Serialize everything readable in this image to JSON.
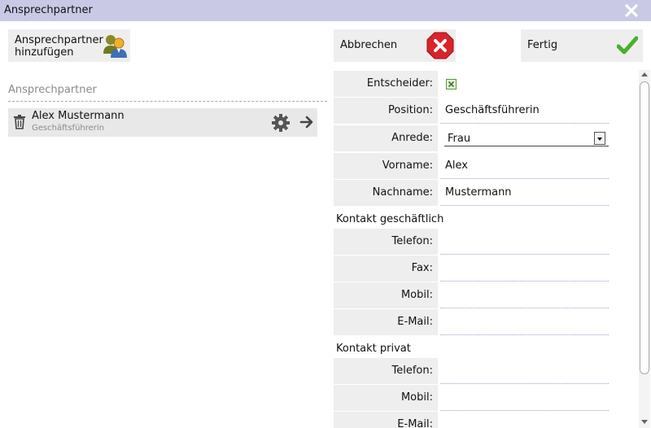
{
  "window": {
    "title": "Ansprechpartner"
  },
  "toolbar": {
    "add_line1": "Ansprechpartner",
    "add_line2": "hinzufügen",
    "cancel_label": "Abbrechen",
    "done_label": "Fertig"
  },
  "list": {
    "heading": "Ansprechpartner",
    "items": [
      {
        "name": "Alex Mustermann",
        "role": "Geschäftsführerin"
      }
    ]
  },
  "form": {
    "entscheider": {
      "label": "Entscheider:",
      "checked": true
    },
    "position": {
      "label": "Position:",
      "value": "Geschäftsführerin"
    },
    "anrede": {
      "label": "Anrede:",
      "value": "Frau"
    },
    "vorname": {
      "label": "Vorname:",
      "value": "Alex"
    },
    "nachname": {
      "label": "Nachname:",
      "value": "Mustermann"
    },
    "business": {
      "title": "Kontakt geschäftlich",
      "telefon": {
        "label": "Telefon:",
        "value": ""
      },
      "fax": {
        "label": "Fax:",
        "value": ""
      },
      "mobil": {
        "label": "Mobil:",
        "value": ""
      },
      "email": {
        "label": "E-Mail:",
        "value": ""
      }
    },
    "private": {
      "title": "Kontakt privat",
      "telefon": {
        "label": "Telefon:",
        "value": ""
      },
      "mobil": {
        "label": "Mobil:",
        "value": ""
      },
      "email": {
        "label": "E-Mail:",
        "value": ""
      }
    }
  },
  "colors": {
    "titlebar": "#c9c9e6",
    "panel": "#eeeeee",
    "cancel_red": "#d9232a",
    "done_green": "#4caf2a",
    "checkbox_green": "#5a9a3a"
  },
  "icons": {
    "close": "close-icon",
    "add_user": "users-icon",
    "cancel": "cancel-x-icon",
    "done": "checkmark-icon",
    "delete": "trash-icon",
    "settings": "gear-icon",
    "open": "arrow-right-icon",
    "dropdown": "chevron-down-icon"
  }
}
